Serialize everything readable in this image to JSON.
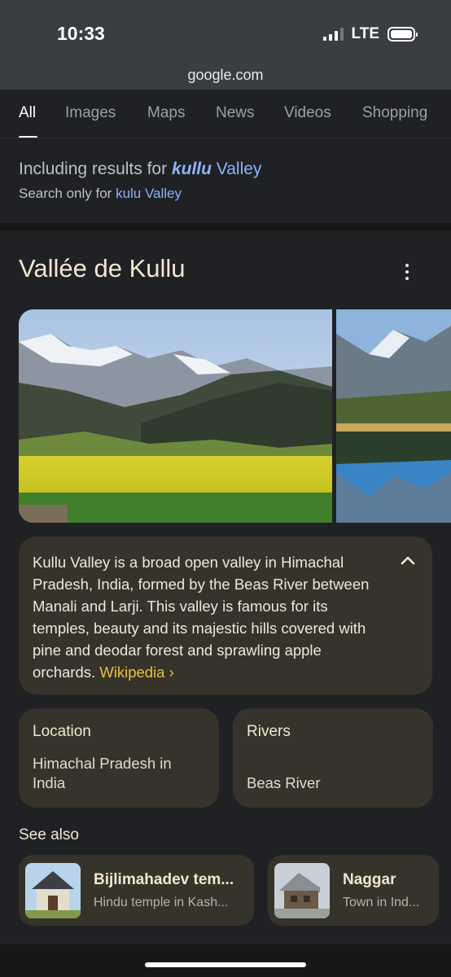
{
  "status_bar": {
    "time": "10:33",
    "network": "LTE",
    "signal_bars_active": 3,
    "signal_bars_total": 4
  },
  "browser": {
    "url": "google.com"
  },
  "tabs": [
    {
      "label": "All",
      "active": true
    },
    {
      "label": "Images",
      "active": false
    },
    {
      "label": "Maps",
      "active": false
    },
    {
      "label": "News",
      "active": false
    },
    {
      "label": "Videos",
      "active": false
    },
    {
      "label": "Shopping",
      "active": false
    }
  ],
  "spell_correction": {
    "prefix": "Including results for ",
    "corrected_bold": "kullu",
    "corrected_rest": " Valley",
    "search_only_prefix": "Search only for ",
    "original_query": "kulu Valley"
  },
  "knowledge_panel": {
    "title": "Vallée de Kullu",
    "description": "Kullu Valley is a broad open valley in Himachal Pradesh, India, formed by the Beas River between Manali and Larji. This valley is famous for its temples, beauty and its majestic hills covered with pine and deodar forest and sprawling apple orchards.",
    "source_link": "Wikipedia ›",
    "facts": [
      {
        "label": "Location",
        "value": "Himachal Pradesh in India"
      },
      {
        "label": "Rivers",
        "value": "Beas River"
      }
    ],
    "see_also_heading": "See also",
    "see_also": [
      {
        "name": "Bijlimahadev tem...",
        "subtitle": "Hindu temple in Kash..."
      },
      {
        "name": "Naggar",
        "subtitle": "Town in Ind..."
      }
    ]
  },
  "colors": {
    "background": "#202124",
    "card": "#36332b",
    "link_blue": "#8ab4f8",
    "wiki_gold": "#e6c33e",
    "title_cream": "#f1e7d0"
  }
}
